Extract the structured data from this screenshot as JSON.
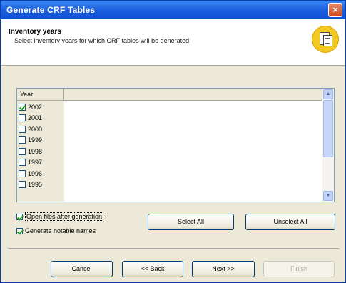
{
  "window": {
    "title": "Generate CRF Tables",
    "close_symbol": "×"
  },
  "header": {
    "title": "Inventory years",
    "description": "Select inventory years for which CRF tables will be generated",
    "icon": "documents-icon"
  },
  "list": {
    "column_header": "Year",
    "items": [
      {
        "label": "2002",
        "checked": true
      },
      {
        "label": "2001",
        "checked": false
      },
      {
        "label": "2000",
        "checked": false
      },
      {
        "label": "1999",
        "checked": false
      },
      {
        "label": "1998",
        "checked": false
      },
      {
        "label": "1997",
        "checked": false
      },
      {
        "label": "1996",
        "checked": false
      },
      {
        "label": "1995",
        "checked": false
      }
    ]
  },
  "options": {
    "open_files_label": "Open files after generation",
    "open_files_checked": true,
    "generate_names_label": "Generate notable names",
    "generate_names_checked": true
  },
  "buttons": {
    "select_all": "Select All",
    "unselect_all": "Unselect All",
    "cancel": "Cancel",
    "back": "<< Back",
    "next": "Next >>",
    "finish": "Finish"
  },
  "colors": {
    "titlebar": "#1f63e0",
    "dialog_bg": "#ece9d8",
    "header_icon": "#f3c820"
  }
}
